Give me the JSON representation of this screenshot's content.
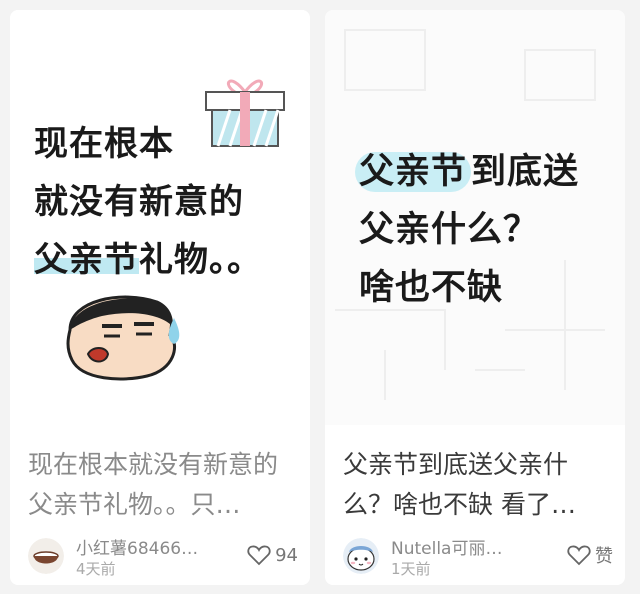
{
  "cards": [
    {
      "cover_lines": [
        "现在根本",
        "就没有新意的",
        "父亲节",
        "礼物。。"
      ],
      "title": "现在根本就没有新意的父亲节礼物。。只…",
      "author": "小红薯68466…",
      "time": "4天前",
      "likes": "94",
      "avatar_icon": "coconut-bowl-icon",
      "like_icon": "heart-outline-icon"
    },
    {
      "cover_lines": [
        "父亲节",
        "到底送",
        "父亲什么？",
        "啥也不缺"
      ],
      "title": "父亲节到底送父亲什么？啥也不缺 看了…",
      "author": "Nutella可丽…",
      "time": "1天前",
      "likes": "赞",
      "avatar_icon": "cartoon-character-icon",
      "like_icon": "heart-outline-icon"
    }
  ],
  "colors": {
    "highlight": "#bfe9f2",
    "gift_box": "#a9dde6",
    "ribbon": "#f2aab8",
    "sweat_drop": "#8fd3ea"
  }
}
